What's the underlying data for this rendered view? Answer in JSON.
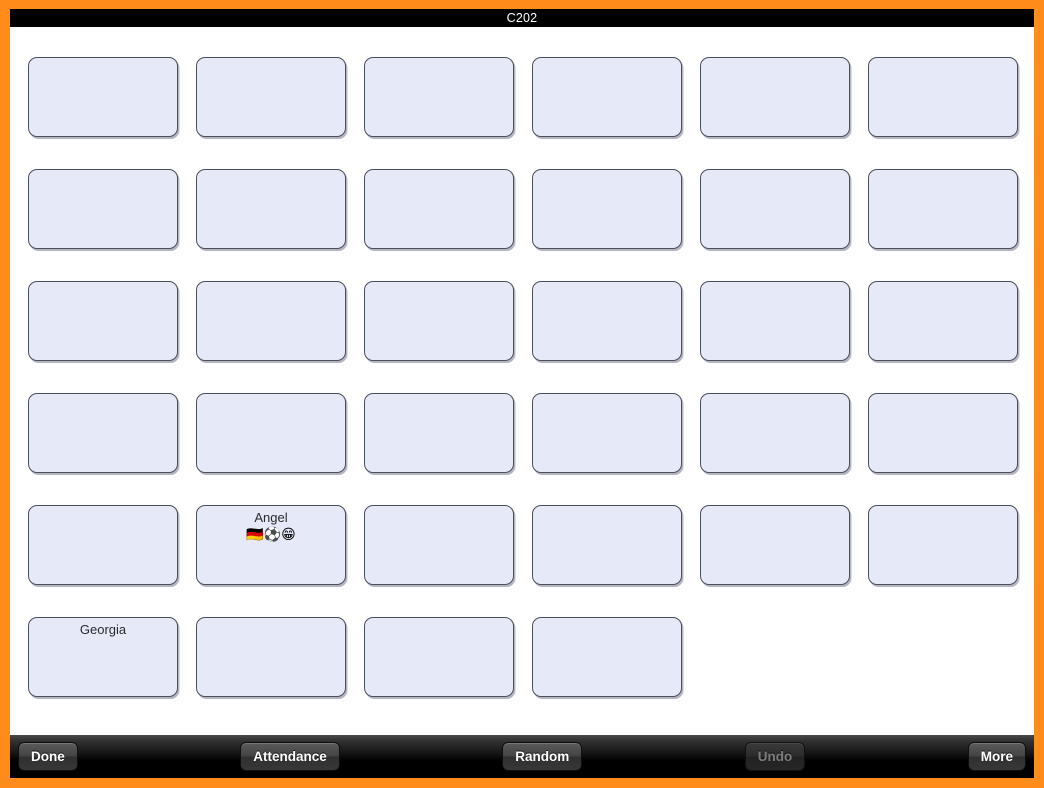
{
  "window": {
    "title": "C202",
    "frame_color": "#ff8c1a",
    "titlebar_bg": "#000000",
    "titlebar_text_color": "#ffffff"
  },
  "seating": {
    "columns": 6,
    "card_fill_color": "#e6eaf8",
    "card_border_color": "#4a4f5e",
    "rows": [
      [
        {
          "name": "",
          "badges": "",
          "empty": true
        },
        {
          "name": "",
          "badges": "",
          "empty": true
        },
        {
          "name": "",
          "badges": "",
          "empty": true
        },
        {
          "name": "",
          "badges": "",
          "empty": true
        },
        {
          "name": "",
          "badges": "",
          "empty": true
        },
        {
          "name": "",
          "badges": "",
          "empty": true
        }
      ],
      [
        {
          "name": "",
          "badges": "",
          "empty": true
        },
        {
          "name": "",
          "badges": "",
          "empty": true
        },
        {
          "name": "",
          "badges": "",
          "empty": true
        },
        {
          "name": "",
          "badges": "",
          "empty": true
        },
        {
          "name": "",
          "badges": "",
          "empty": true
        },
        {
          "name": "",
          "badges": "",
          "empty": true
        }
      ],
      [
        {
          "name": "",
          "badges": "",
          "empty": true
        },
        {
          "name": "",
          "badges": "",
          "empty": true
        },
        {
          "name": "",
          "badges": "",
          "empty": true
        },
        {
          "name": "",
          "badges": "",
          "empty": true
        },
        {
          "name": "",
          "badges": "",
          "empty": true
        },
        {
          "name": "",
          "badges": "",
          "empty": true
        }
      ],
      [
        {
          "name": "",
          "badges": "",
          "empty": true
        },
        {
          "name": "",
          "badges": "",
          "empty": true
        },
        {
          "name": "",
          "badges": "",
          "empty": true
        },
        {
          "name": "",
          "badges": "",
          "empty": true
        },
        {
          "name": "",
          "badges": "",
          "empty": true
        },
        {
          "name": "",
          "badges": "",
          "empty": true
        }
      ],
      [
        {
          "name": "",
          "badges": "",
          "empty": true
        },
        {
          "name": "Angel",
          "badges": "🇩🇪⚽😁",
          "empty": false
        },
        {
          "name": "",
          "badges": "",
          "empty": true
        },
        {
          "name": "",
          "badges": "",
          "empty": true
        },
        {
          "name": "",
          "badges": "",
          "empty": true
        },
        {
          "name": "",
          "badges": "",
          "empty": true
        }
      ],
      [
        {
          "name": "Georgia",
          "badges": "",
          "empty": false
        },
        {
          "name": "",
          "badges": "",
          "empty": true
        },
        {
          "name": "",
          "badges": "",
          "empty": true
        },
        {
          "name": "",
          "badges": "",
          "empty": true
        }
      ]
    ]
  },
  "toolbar": {
    "done_label": "Done",
    "attendance_label": "Attendance",
    "random_label": "Random",
    "undo_label": "Undo",
    "undo_disabled": true,
    "more_label": "More"
  }
}
